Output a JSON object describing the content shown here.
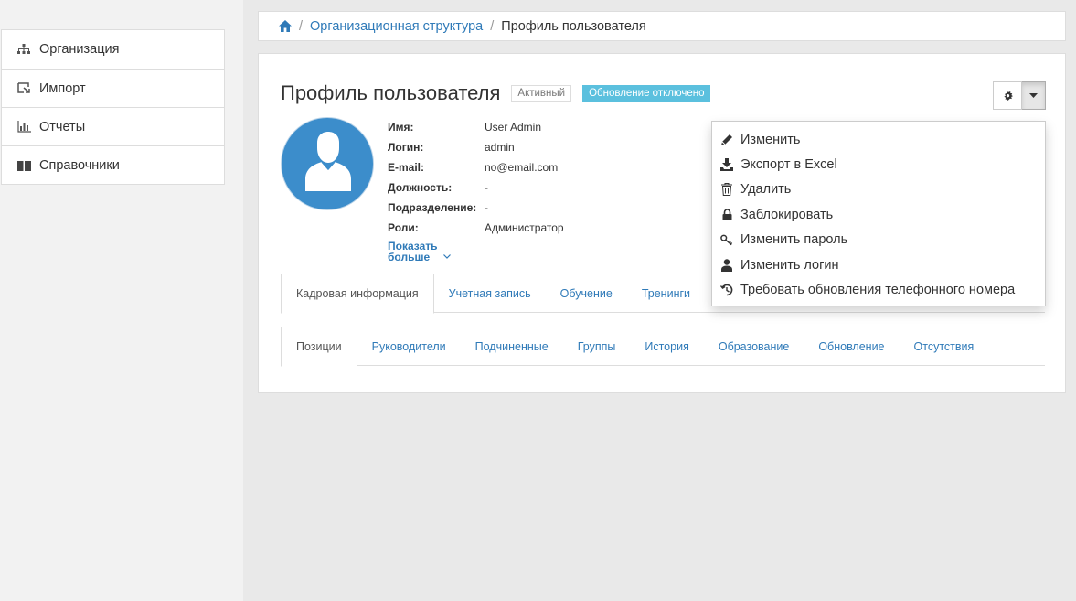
{
  "sidebar": {
    "items": [
      {
        "label": "Организация",
        "icon": "sitemap-icon"
      },
      {
        "label": "Импорт",
        "icon": "import-icon"
      },
      {
        "label": "Отчеты",
        "icon": "chart-icon"
      },
      {
        "label": "Справочники",
        "icon": "book-icon"
      }
    ]
  },
  "breadcrumb": {
    "home_icon": "home-icon",
    "separator": "/",
    "link": "Организационная структура",
    "current": "Профиль пользователя"
  },
  "profile": {
    "title": "Профиль пользователя",
    "badge_active": "Активный",
    "badge_update": "Обновление отключено",
    "fields": [
      {
        "key": "Имя:",
        "value": "User Admin"
      },
      {
        "key": "Логин:",
        "value": "admin"
      },
      {
        "key": "E-mail:",
        "value": "no@email.com"
      },
      {
        "key": "Должность:",
        "value": "-"
      },
      {
        "key": "Подразделение:",
        "value": "-"
      },
      {
        "key": "Роли:",
        "value": "Администратор"
      }
    ],
    "show_more_line1": "Показать",
    "show_more_line2": "больше"
  },
  "tabs_primary": [
    "Кадровая информация",
    "Учетная запись",
    "Обучение",
    "Тренинги"
  ],
  "tabs_secondary": [
    "Позиции",
    "Руководители",
    "Подчиненные",
    "Группы",
    "История",
    "Образование",
    "Обновление",
    "Отсутствия"
  ],
  "dropdown": {
    "items": [
      {
        "label": "Изменить",
        "icon": "pencil-icon"
      },
      {
        "label": "Экспорт в Excel",
        "icon": "download-icon"
      },
      {
        "label": "Удалить",
        "icon": "trash-icon"
      },
      {
        "label": "Заблокировать",
        "icon": "lock-icon"
      },
      {
        "label": "Изменить пароль",
        "icon": "key-icon"
      },
      {
        "label": "Изменить логин",
        "icon": "user-icon"
      },
      {
        "label": "Требовать обновления телефонного номера",
        "icon": "history-icon"
      }
    ]
  },
  "colors": {
    "link": "#2f7ab8",
    "avatar_bg": "#3c8dcb",
    "badge_update_bg": "#5bc0de",
    "page_bg": "#e9e9e9"
  }
}
